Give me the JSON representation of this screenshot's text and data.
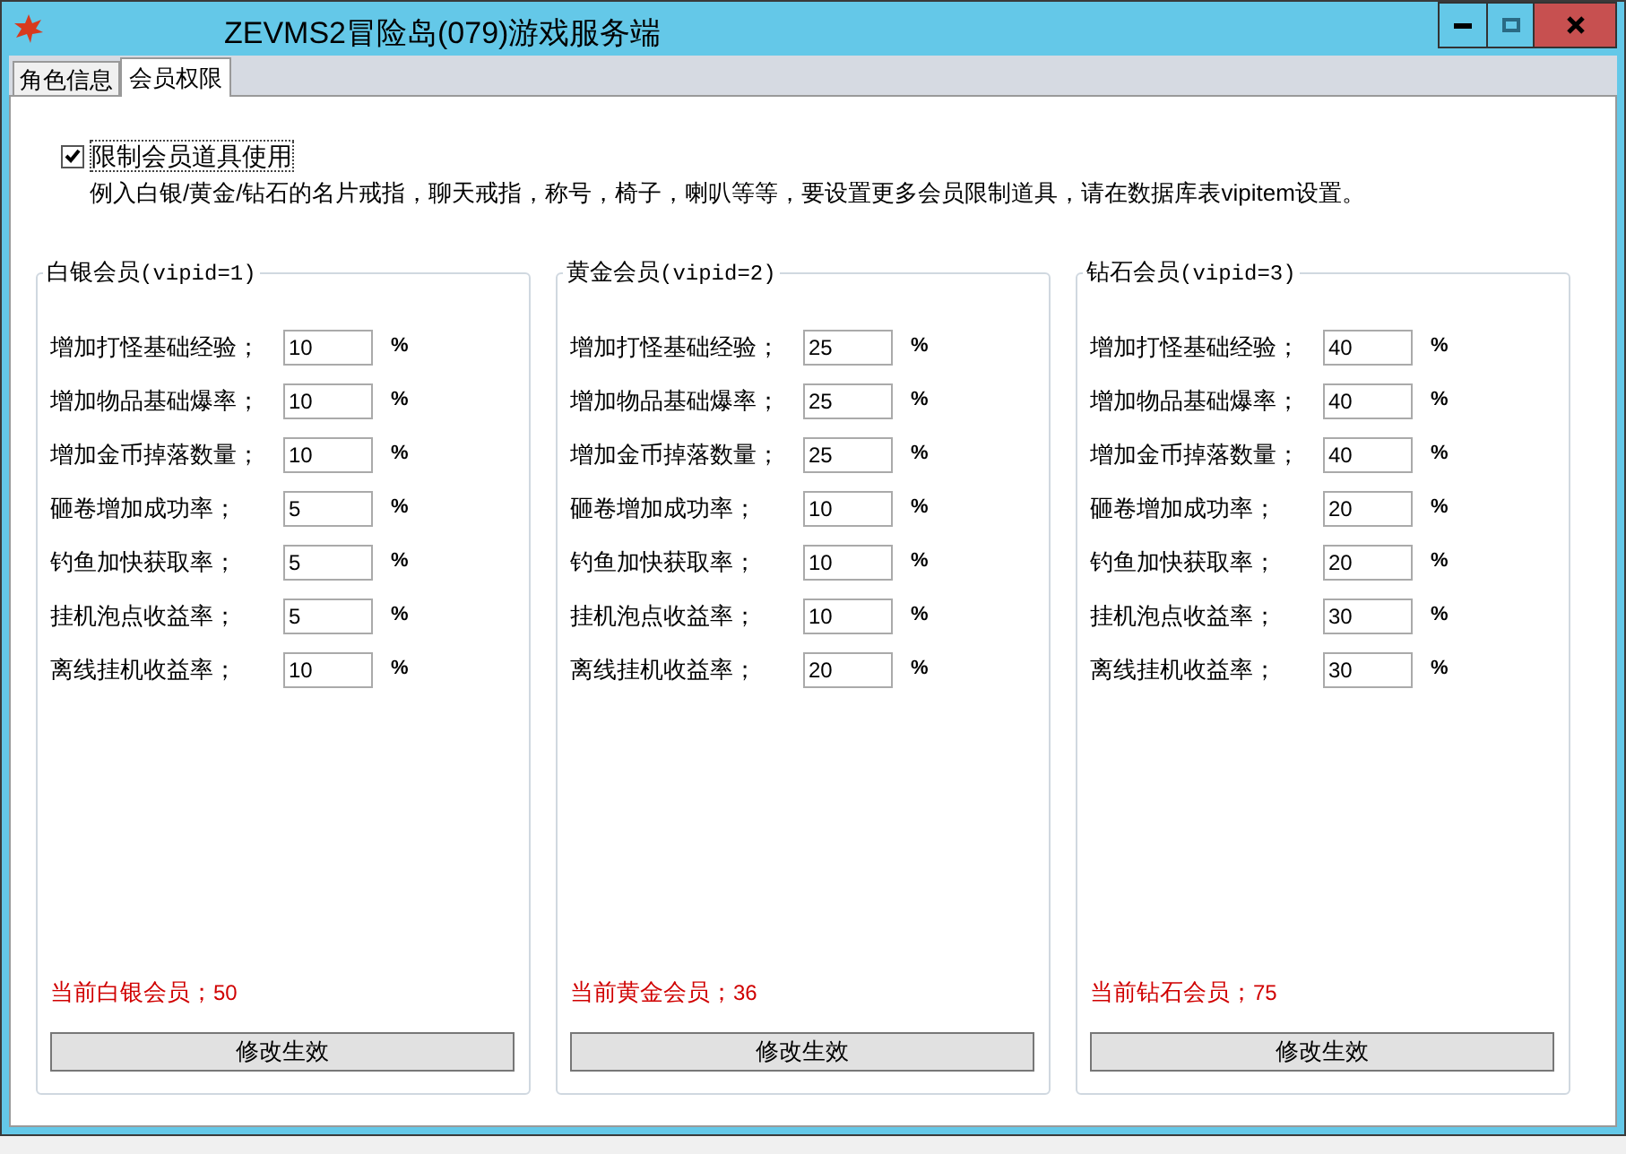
{
  "window": {
    "title": "ZEVMS2冒险岛(079)游戏服务端"
  },
  "tabs": [
    {
      "label": "角色信息",
      "selected": false
    },
    {
      "label": "会员权限",
      "selected": true
    }
  ],
  "restrict": {
    "label": "限制会员道具使用",
    "checked": true,
    "note": "例入白银/黄金/钻石的名片戒指，聊天戒指，称号，椅子，喇叭等等，要设置更多会员限制道具，请在数据库表vipitem设置。"
  },
  "groups": [
    {
      "title": "白银会员",
      "vipid": "(vipid=1)",
      "fields": [
        {
          "label": "增加打怪基础经验；",
          "value": "10",
          "unit": "%"
        },
        {
          "label": "增加物品基础爆率；",
          "value": "10",
          "unit": "%"
        },
        {
          "label": "增加金币掉落数量；",
          "value": "10",
          "unit": "%"
        },
        {
          "label": "砸卷增加成功率；",
          "value": "5",
          "unit": "%"
        },
        {
          "label": "钓鱼加快获取率；",
          "value": "5",
          "unit": "%"
        },
        {
          "label": "挂机泡点收益率；",
          "value": "5",
          "unit": "%"
        },
        {
          "label": "离线挂机收益率；",
          "value": "10",
          "unit": "%"
        }
      ],
      "count_label": "当前白银会员；",
      "count": "50",
      "button": "修改生效"
    },
    {
      "title": "黄金会员",
      "vipid": "(vipid=2)",
      "fields": [
        {
          "label": "增加打怪基础经验；",
          "value": "25",
          "unit": "%"
        },
        {
          "label": "增加物品基础爆率；",
          "value": "25",
          "unit": "%"
        },
        {
          "label": "增加金币掉落数量；",
          "value": "25",
          "unit": "%"
        },
        {
          "label": "砸卷增加成功率；",
          "value": "10",
          "unit": "%"
        },
        {
          "label": "钓鱼加快获取率；",
          "value": "10",
          "unit": "%"
        },
        {
          "label": "挂机泡点收益率；",
          "value": "10",
          "unit": "%"
        },
        {
          "label": "离线挂机收益率；",
          "value": "20",
          "unit": "%"
        }
      ],
      "count_label": "当前黄金会员；",
      "count": "36",
      "button": "修改生效"
    },
    {
      "title": "钻石会员",
      "vipid": "(vipid=3)",
      "fields": [
        {
          "label": "增加打怪基础经验；",
          "value": "40",
          "unit": "%"
        },
        {
          "label": "增加物品基础爆率；",
          "value": "40",
          "unit": "%"
        },
        {
          "label": "增加金币掉落数量；",
          "value": "40",
          "unit": "%"
        },
        {
          "label": "砸卷增加成功率；",
          "value": "20",
          "unit": "%"
        },
        {
          "label": "钓鱼加快获取率；",
          "value": "20",
          "unit": "%"
        },
        {
          "label": "挂机泡点收益率；",
          "value": "30",
          "unit": "%"
        },
        {
          "label": "离线挂机收益率；",
          "value": "30",
          "unit": "%"
        }
      ],
      "count_label": "当前钻石会员；",
      "count": "75",
      "button": "修改生效"
    }
  ]
}
